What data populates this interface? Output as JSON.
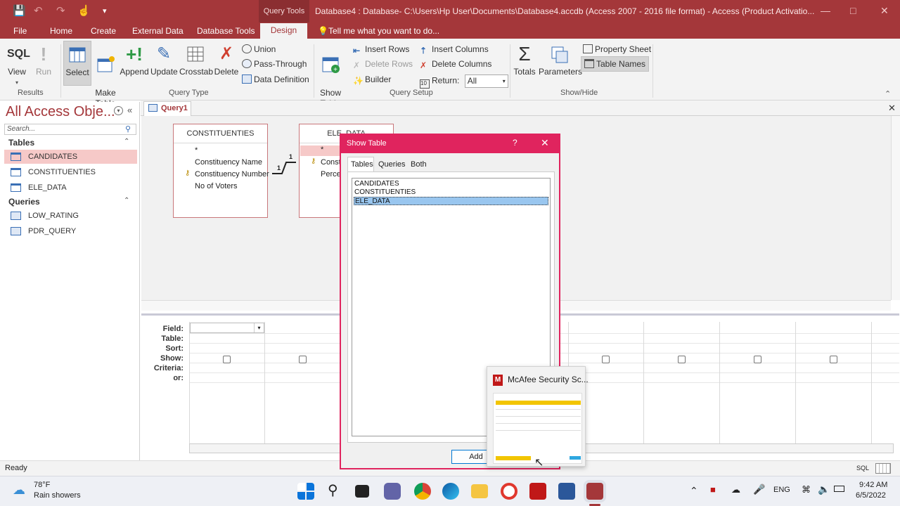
{
  "titlebar": {
    "context_tab": "Query Tools",
    "title": "Database4 : Database- C:\\Users\\Hp User\\Documents\\Database4.accdb (Access 2007 - 2016 file format) - Access (Product Activatio..."
  },
  "menu": {
    "file": "File",
    "home": "Home",
    "create": "Create",
    "external": "External Data",
    "dbtools": "Database Tools",
    "design": "Design",
    "tellme": "Tell me what you want to do..."
  },
  "ribbon": {
    "results": {
      "view": "View",
      "run": "Run",
      "group": "Results",
      "sql": "SQL"
    },
    "querytype": {
      "select": "Select",
      "make_table": "Make\nTable",
      "append": "Append",
      "update": "Update",
      "crosstab": "Crosstab",
      "delete": "Delete",
      "union": "Union",
      "pass_through": "Pass-Through",
      "data_definition": "Data Definition",
      "group": "Query Type"
    },
    "setup": {
      "show_table": "Show\nTable",
      "insert_rows": "Insert Rows",
      "delete_rows": "Delete Rows",
      "builder": "Builder",
      "insert_columns": "Insert Columns",
      "delete_columns": "Delete Columns",
      "return_label": "Return:",
      "return_value": "All",
      "group": "Query Setup"
    },
    "showhide": {
      "totals": "Totals",
      "parameters": "Parameters",
      "property_sheet": "Property Sheet",
      "table_names": "Table Names",
      "group": "Show/Hide"
    }
  },
  "nav": {
    "title": "All Access Obje...",
    "search_placeholder": "Search...",
    "tables_header": "Tables",
    "tables": [
      "CANDIDATES",
      "CONSTITUENTIES",
      "ELE_DATA"
    ],
    "queries_header": "Queries",
    "queries": [
      "LOW_RATING",
      "PDR_QUERY"
    ]
  },
  "doc": {
    "tab": "Query1",
    "table1": {
      "name": "CONSTITUENTIES",
      "fields": [
        "*",
        "Constituency Name",
        "Constituency Number",
        "No of Voters"
      ]
    },
    "table2": {
      "name": "ELE_DATA",
      "fields": [
        "*",
        "Const",
        "Percer"
      ]
    },
    "rel_left": "1",
    "rel_right": "1"
  },
  "grid": {
    "labels": [
      "Field:",
      "Table:",
      "Sort:",
      "Show:",
      "Criteria:",
      "or:"
    ]
  },
  "dialog": {
    "title": "Show Table",
    "help": "?",
    "tabs": [
      "Tables",
      "Queries",
      "Both"
    ],
    "items": [
      "CANDIDATES",
      "CONSTITUENTIES",
      "ELE_DATA"
    ],
    "selected": "ELE_DATA",
    "add_button": "Add"
  },
  "mcafee": {
    "title": "McAfee Security Sc..."
  },
  "status": {
    "text": "Ready",
    "sql": "SQL"
  },
  "taskbar": {
    "temp": "78°F",
    "weather": "Rain showers",
    "lang": "ENG",
    "time": "9:42 AM",
    "date": "6/5/2022"
  },
  "colors": {
    "access_red": "#a4373a",
    "dialog_pink": "#e0245e",
    "selection": "#f6c9c8"
  }
}
